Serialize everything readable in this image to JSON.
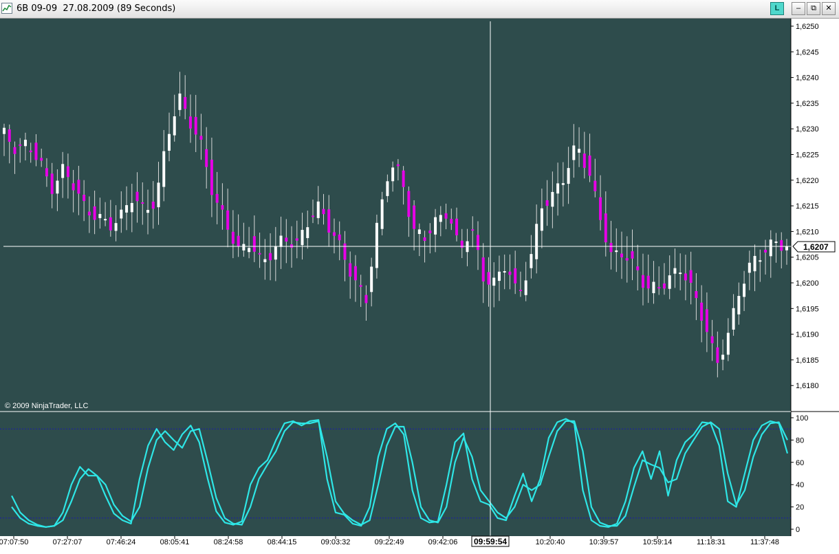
{
  "window": {
    "title": "6B 09-09  27.08.2009 (89 Seconds)",
    "link_button_label": "L",
    "minimize_label": "–",
    "restore_label": "⧉",
    "close_label": "✕"
  },
  "colors": {
    "background": "#2e4c4c",
    "up_candle": "#ffffff",
    "down_candle": "#e600e6",
    "wick": "#d8d8d8",
    "oscillator": "#2ee6e6",
    "level_lines": "#1a1aa8",
    "crosshair": "#ffffff"
  },
  "chart": {
    "copyright": "© 2009 NinjaTrader, LLC",
    "current_price_label": "1,6207",
    "crosshair_time_label": "09:59:54",
    "price_ticks": [
      "1,6250",
      "1,6245",
      "1,6240",
      "1,6235",
      "1,6230",
      "1,6225",
      "1,6220",
      "1,6215",
      "1,6210",
      "1,6205",
      "1,6200",
      "1,6195",
      "1,6190",
      "1,6185",
      "1,6180"
    ],
    "oscillator_ticks": [
      "100",
      "80",
      "60",
      "40",
      "20",
      "0"
    ],
    "time_ticks": [
      "07:07:50",
      "07:27:07",
      "07:46:24",
      "08:05:41",
      "08:24:58",
      "08:44:15",
      "09:03:32",
      "09:22:49",
      "09:42:06",
      "10:20:40",
      "10:39:57",
      "10:59:14",
      "11:18:31",
      "11:37:48"
    ]
  },
  "chart_data": {
    "type": "candlestick",
    "instrument": "6B 09-09",
    "interval": "89 Seconds",
    "date": "27.08.2009",
    "price_range": [
      1.61765,
      1.62515
    ],
    "oscillator_range": [
      0,
      100
    ],
    "oscillator_levels": [
      10,
      90
    ],
    "last_price": 1.6207,
    "price_path": [
      1.6229,
      1.6226,
      1.6227,
      1.6224,
      1.6218,
      1.6222,
      1.6219,
      1.6214,
      1.6213,
      1.6211,
      1.6213,
      1.6217,
      1.6214,
      1.6216,
      1.6229,
      1.6236,
      1.6231,
      1.6226,
      1.6216,
      1.6212,
      1.6206,
      1.6208,
      1.6204,
      1.6206,
      1.6209,
      1.6207,
      1.6212,
      1.6215,
      1.621,
      1.6206,
      1.62,
      1.6197,
      1.6212,
      1.6223,
      1.6221,
      1.621,
      1.6209,
      1.6212,
      1.6214,
      1.6206,
      1.6211,
      1.6201,
      1.62,
      1.6204,
      1.6197,
      1.6204,
      1.6215,
      1.6217,
      1.6221,
      1.6227,
      1.6222,
      1.6213,
      1.6205,
      1.6206,
      1.6203,
      1.6199,
      1.6199,
      1.6201,
      1.6203,
      1.6198,
      1.6192,
      1.6184,
      1.619,
      1.6199,
      1.6204,
      1.6206,
      1.6208,
      1.6207
    ],
    "oscillator_fast": [
      30,
      15,
      8,
      4,
      2,
      3,
      15,
      40,
      56,
      48,
      48,
      30,
      14,
      8,
      5,
      45,
      75,
      90,
      78,
      71,
      85,
      93,
      78,
      45,
      16,
      6,
      4,
      7,
      40,
      55,
      62,
      80,
      95,
      97,
      93,
      97,
      98,
      45,
      15,
      13,
      5,
      3,
      20,
      65,
      90,
      95,
      85,
      35,
      10,
      6,
      7,
      40,
      78,
      86,
      45,
      25,
      22,
      10,
      8,
      30,
      50,
      25,
      45,
      82,
      96,
      99,
      95,
      35,
      8,
      3,
      2,
      5,
      25,
      55,
      70,
      45,
      70,
      30,
      62,
      78,
      85,
      96,
      95,
      75,
      25,
      20,
      50,
      80,
      93,
      97,
      95,
      68
    ],
    "oscillator_slow": [
      20,
      10,
      5,
      3,
      2,
      3,
      8,
      25,
      45,
      54,
      48,
      40,
      22,
      12,
      7,
      20,
      55,
      80,
      88,
      80,
      73,
      88,
      90,
      60,
      28,
      10,
      5,
      4,
      20,
      45,
      58,
      70,
      88,
      96,
      95,
      95,
      97,
      65,
      25,
      14,
      8,
      4,
      8,
      40,
      75,
      92,
      92,
      60,
      20,
      8,
      6,
      20,
      60,
      82,
      65,
      35,
      25,
      15,
      10,
      20,
      40,
      35,
      40,
      65,
      88,
      97,
      97,
      70,
      20,
      6,
      3,
      3,
      12,
      38,
      62,
      58,
      55,
      42,
      45,
      68,
      80,
      92,
      96,
      90,
      50,
      22,
      35,
      65,
      85,
      95,
      96,
      80
    ]
  }
}
